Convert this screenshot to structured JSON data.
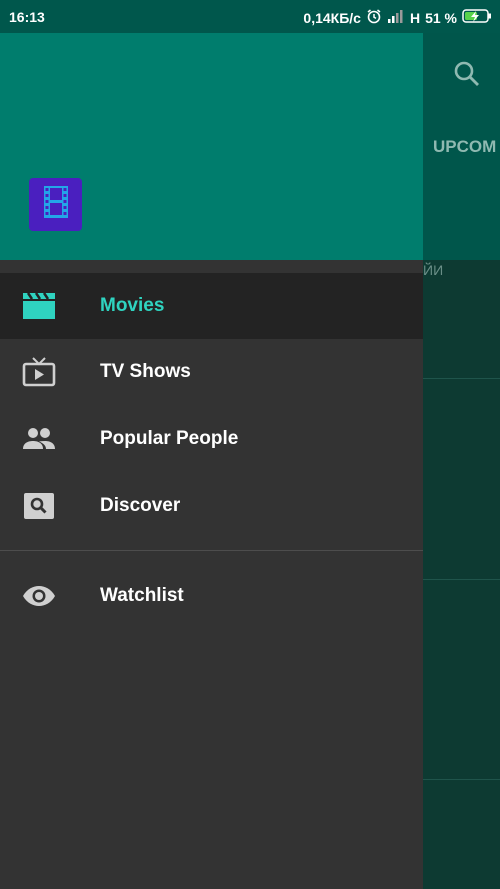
{
  "status_bar": {
    "time": "16:13",
    "net_speed": "0,14КБ/с",
    "network_type": "H",
    "battery": "51 %"
  },
  "background_app": {
    "tab_label": "UPCOM",
    "subhead": "ЙИ"
  },
  "drawer": {
    "logo_icon": "film-icon",
    "items": [
      {
        "label": "Movies",
        "icon": "clapperboard-icon",
        "selected": true
      },
      {
        "label": "TV Shows",
        "icon": "tv-icon",
        "selected": false
      },
      {
        "label": "Popular People",
        "icon": "people-icon",
        "selected": false
      },
      {
        "label": "Discover",
        "icon": "search-box-icon",
        "selected": false
      },
      {
        "label": "Watchlist",
        "icon": "eye-icon",
        "selected": false
      }
    ]
  },
  "colors": {
    "accent": "#2fd3c0",
    "header": "#007d6d",
    "drawer_bg": "#333333",
    "logo_bg": "#4a1fbf"
  }
}
